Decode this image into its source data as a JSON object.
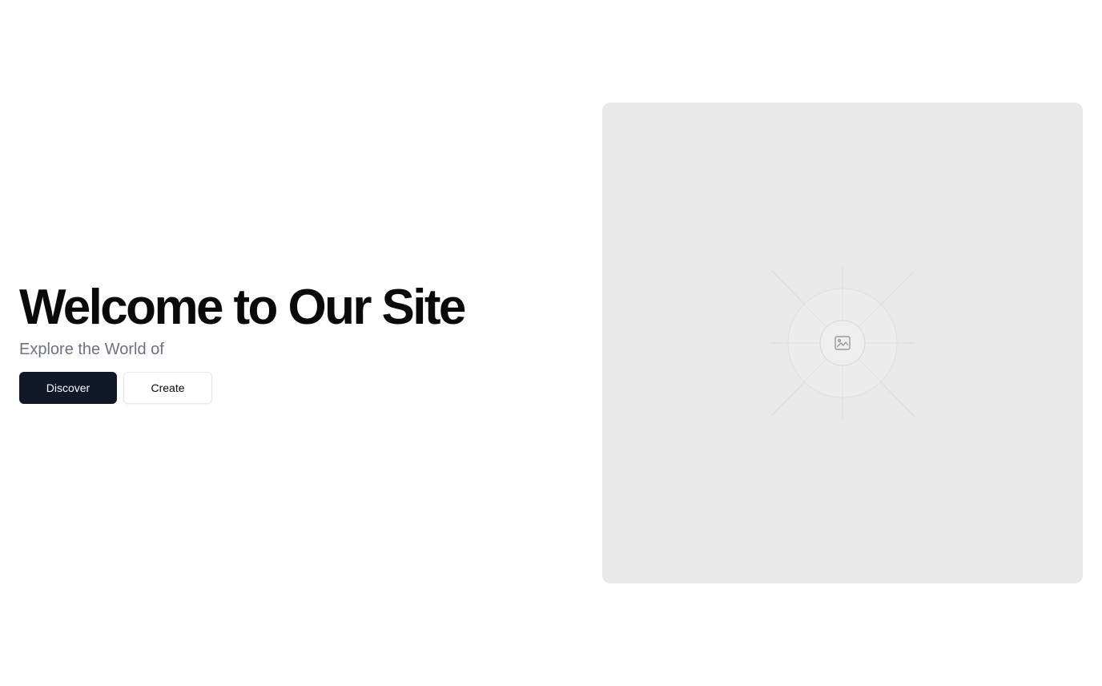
{
  "hero": {
    "title": "Welcome to Our Site",
    "subtitle": "Explore the World of",
    "primary_button": "Discover",
    "secondary_button": "Create"
  },
  "media": {
    "icon": "image-placeholder-icon"
  },
  "colors": {
    "background": "#ffffff",
    "title": "#0a0a0a",
    "subtitle": "#6b7280",
    "primary_button_bg": "#111827",
    "primary_button_text": "#f9fafb",
    "secondary_button_border": "#e5e7eb",
    "placeholder_bg": "#e9e9e9"
  }
}
